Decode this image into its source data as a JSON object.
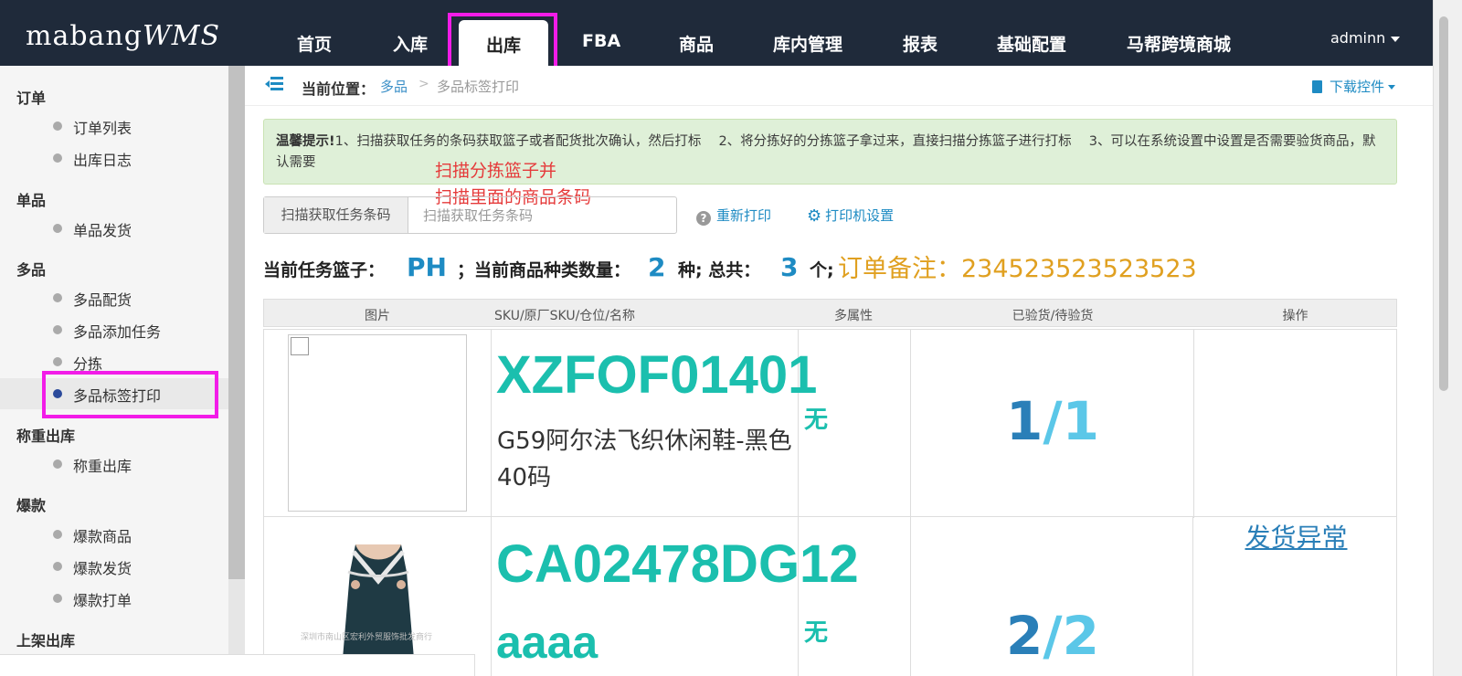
{
  "app": {
    "logo_main": "mabang",
    "logo_suffix": "WMS",
    "user": "adminn"
  },
  "nav": {
    "items": [
      "首页",
      "入库",
      "出库",
      "FBA",
      "商品",
      "库内管理",
      "报表",
      "基础配置",
      "马帮跨境商城"
    ],
    "active": "出库"
  },
  "sidebar": {
    "groups": [
      {
        "title": "订单",
        "items": [
          "订单列表",
          "出库日志"
        ]
      },
      {
        "title": "单品",
        "items": [
          "单品发货"
        ]
      },
      {
        "title": "多品",
        "items": [
          "多品配货",
          "多品添加任务",
          "分拣",
          "多品标签打印"
        ]
      },
      {
        "title": "称重出库",
        "items": [
          "称重出库"
        ]
      },
      {
        "title": "爆款",
        "items": [
          "爆款商品",
          "爆款发货",
          "爆款打单"
        ]
      },
      {
        "title": "上架出库",
        "items": []
      }
    ],
    "active_item": "多品标签打印"
  },
  "breadcrumb": {
    "label": "当前位置：",
    "parent": "多品",
    "separator": ">",
    "current": "多品标签打印"
  },
  "download": {
    "label": "下载控件"
  },
  "tip": {
    "title": "温馨提示!",
    "text": "1、扫描获取任务的条码获取篮子或者配货批次确认，然后打标　 2、将分拣好的分拣篮子拿过来，直接扫描分拣篮子进行打标　 3、可以在系统设置中设置是否需要验货商品，默认需要"
  },
  "overlay": {
    "line1": "扫描分拣篮子并",
    "line2": "扫描里面的商品条码"
  },
  "scan": {
    "addon": "扫描获取任务条码",
    "placeholder": "扫描获取任务条码",
    "value": ""
  },
  "actions": {
    "reprint": "重新打印",
    "printer_settings": "打印机设置"
  },
  "status": {
    "basket_label": "当前任务篮子：",
    "basket_value": "PH",
    "kinds_label": "；当前商品种类数量：",
    "kinds_value": "2",
    "kinds_unit": "种; 总共：",
    "total_value": "3",
    "total_unit": "个;",
    "note": "订单备注：234523523523523"
  },
  "table": {
    "headers": [
      "图片",
      "SKU/原厂SKU/仓位/名称",
      "多属性",
      "已验货/待验货",
      "操作"
    ],
    "rows": [
      {
        "sku": "XZFOF01401",
        "name": "G59阿尔法飞织休闲鞋-黑色40码",
        "attr": "无",
        "checked": "1",
        "pending": "/1"
      },
      {
        "sku": "CA02478DG12",
        "name": "aaaa",
        "attr": "无",
        "checked": "2",
        "pending": "/2",
        "watermark": "深圳市南山区宏利外贸服饰批发商行"
      }
    ],
    "action": "发货异常"
  },
  "colors": {
    "topbar": "#1f2a3a",
    "highlight": "#f21ce8",
    "accent": "#1e8bc3",
    "sku": "#1bbfae",
    "note": "#e0a020",
    "overlay": "#e53a3a"
  }
}
